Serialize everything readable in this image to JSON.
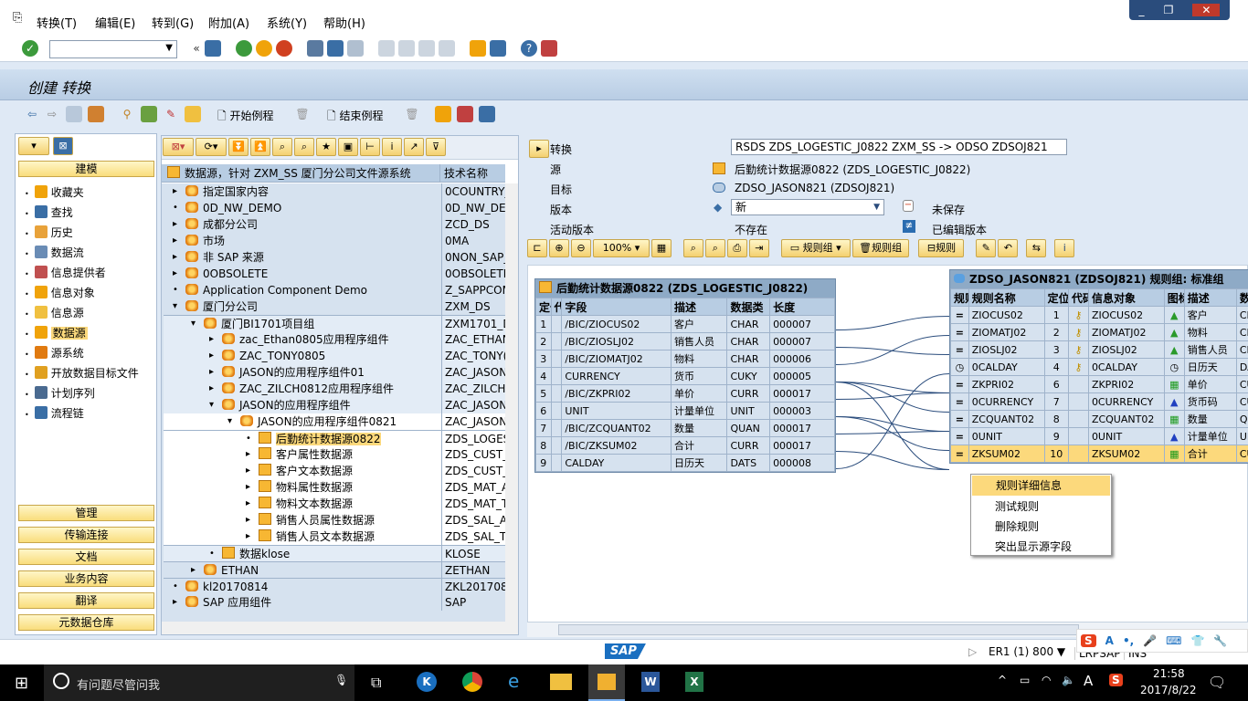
{
  "menu": [
    "转换(T)",
    "编辑(E)",
    "转到(G)",
    "附加(A)",
    "系统(Y)",
    "帮助(H)"
  ],
  "window_buttons": [
    "_",
    "❐",
    "✕"
  ],
  "command_field": "",
  "page_title": "创建 转换",
  "app_toolbar": {
    "start_routine": "开始例程",
    "end_routine": "结束例程"
  },
  "nav": {
    "top_button": "建模",
    "items": [
      {
        "label": "收藏夹",
        "color": "#f0a30a"
      },
      {
        "label": "查找",
        "color": "#3a6ea5"
      },
      {
        "label": "历史",
        "color": "#e8a23a"
      },
      {
        "label": "数据流",
        "color": "#6a8cb5"
      },
      {
        "label": "信息提供者",
        "color": "#c05050"
      },
      {
        "label": "信息对象",
        "color": "#f0a30a"
      },
      {
        "label": "信息源",
        "color": "#f0c040"
      },
      {
        "label": "数据源",
        "color": "#f0a30a",
        "selected": true
      },
      {
        "label": "源系统",
        "color": "#e07a10"
      },
      {
        "label": "开放数据目标文件",
        "color": "#e0a020"
      },
      {
        "label": "计划序列",
        "color": "#4a6a90"
      },
      {
        "label": "流程链",
        "color": "#3a6ea5"
      }
    ],
    "bottom_buttons": [
      "管理",
      "传输连接",
      "文档",
      "业务内容",
      "翻译",
      "元数据仓库"
    ]
  },
  "tree": {
    "header": "数据源，针对 ZXM_SS 厦门分公司文件源系统",
    "tech_header": "技术名称",
    "rows": [
      {
        "label": "指定国家内容",
        "tech": "0COUNTRY_",
        "level": 0,
        "exp": "▸",
        "icon": "folder"
      },
      {
        "label": "0D_NW_DEMO",
        "tech": "0D_NW_DEI",
        "level": 0,
        "exp": "•",
        "icon": "folder"
      },
      {
        "label": "成都分公司",
        "tech": "ZCD_DS",
        "level": 0,
        "exp": "▸",
        "icon": "folder"
      },
      {
        "label": "市场",
        "tech": "0MA",
        "level": 0,
        "exp": "▸",
        "icon": "folder"
      },
      {
        "label": "非 SAP 来源",
        "tech": "0NON_SAP_",
        "level": 0,
        "exp": "▸",
        "icon": "folder"
      },
      {
        "label": "0OBSOLETE",
        "tech": "0OBSOLETE",
        "level": 0,
        "exp": "▸",
        "icon": "folder"
      },
      {
        "label": "Application Component Demo",
        "tech": "Z_SAPPCOM",
        "level": 0,
        "exp": "•",
        "icon": "folder"
      },
      {
        "label": "厦门分公司",
        "tech": "ZXM_DS",
        "level": 0,
        "exp": "▾",
        "icon": "folder"
      },
      {
        "label": "厦门BI1701项目组",
        "tech": "ZXM1701_D",
        "level": 1,
        "exp": "▾",
        "icon": "folder"
      },
      {
        "label": "zac_Ethan0805应用程序组件",
        "tech": "ZAC_ETHAN",
        "level": 2,
        "exp": "▸",
        "icon": "folder"
      },
      {
        "label": "ZAC_TONY0805",
        "tech": "ZAC_TONY(",
        "level": 2,
        "exp": "▸",
        "icon": "folder"
      },
      {
        "label": "JASON的应用程序组件01",
        "tech": "ZAC_JASON",
        "level": 2,
        "exp": "▸",
        "icon": "folder"
      },
      {
        "label": "ZAC_ZILCH0812应用程序组件",
        "tech": "ZAC_ZILCH0",
        "level": 2,
        "exp": "▸",
        "icon": "folder"
      },
      {
        "label": "JASON的应用程序组件",
        "tech": "ZAC_JASON",
        "level": 2,
        "exp": "▾",
        "icon": "folder"
      },
      {
        "label": "JASON的应用程序组件0821",
        "tech": "ZAC_JASON",
        "level": 3,
        "exp": "▾",
        "icon": "folder"
      },
      {
        "label": "后勤统计数据源0822",
        "tech": "ZDS_LOGES",
        "level": 4,
        "exp": "•",
        "icon": "ds",
        "selected": true
      },
      {
        "label": "客户属性数据源",
        "tech": "ZDS_CUST_",
        "level": 4,
        "exp": "▸",
        "icon": "ds"
      },
      {
        "label": "客户文本数据源",
        "tech": "ZDS_CUST_",
        "level": 4,
        "exp": "▸",
        "icon": "ds"
      },
      {
        "label": "物料属性数据源",
        "tech": "ZDS_MAT_A",
        "level": 4,
        "exp": "▸",
        "icon": "ds"
      },
      {
        "label": "物料文本数据源",
        "tech": "ZDS_MAT_T",
        "level": 4,
        "exp": "▸",
        "icon": "ds"
      },
      {
        "label": "销售人员属性数据源",
        "tech": "ZDS_SAL_A",
        "level": 4,
        "exp": "▸",
        "icon": "ds"
      },
      {
        "label": "销售人员文本数据源",
        "tech": "ZDS_SAL_T",
        "level": 4,
        "exp": "▸",
        "icon": "ds"
      },
      {
        "label": "数据klose",
        "tech": "KLOSE",
        "level": 2,
        "exp": "•",
        "icon": "ds"
      },
      {
        "label": "ETHAN",
        "tech": "ZETHAN",
        "level": 1,
        "exp": "▸",
        "icon": "folder"
      },
      {
        "label": "kl20170814",
        "tech": "ZKL2017081",
        "level": 0,
        "exp": "•",
        "icon": "folder"
      },
      {
        "label": "SAP 应用组件",
        "tech": "SAP",
        "level": 0,
        "exp": "▸",
        "icon": "folder"
      }
    ]
  },
  "transform": {
    "label_transform": "转换",
    "value_transform": "RSDS ZDS_LOGESTIC_J0822 ZXM_SS -> ODSO ZDSOJ821",
    "label_source": "源",
    "value_source": "后勤统计数据源0822 (ZDS_LOGESTIC_J0822)",
    "label_target": "目标",
    "value_target": "ZDSO_JASON821 (ZDSOJ821)",
    "label_version": "版本",
    "value_version": "新",
    "status_version": "未保存",
    "label_active": "活动版本",
    "value_active": "不存在",
    "status_active": "已编辑版本"
  },
  "graph_toolbar": {
    "zoom": "100%",
    "rule_group_new": "规则组",
    "rule_group_delete": "规则组",
    "rule": "规则"
  },
  "source_table": {
    "title": "后勤统计数据源0822 (ZDS_LOGESTIC_J0822)",
    "columns": [
      "定位",
      "代",
      "字段",
      "描述",
      "数据类",
      "长度"
    ],
    "rows": [
      [
        "1",
        "",
        "/BIC/ZIOCUS02",
        "客户",
        "CHAR",
        "000007"
      ],
      [
        "2",
        "",
        "/BIC/ZIOSLJ02",
        "销售人员",
        "CHAR",
        "000007"
      ],
      [
        "3",
        "",
        "/BIC/ZIOMATJ02",
        "物料",
        "CHAR",
        "000006"
      ],
      [
        "4",
        "",
        "CURRENCY",
        "货币",
        "CUKY",
        "000005"
      ],
      [
        "5",
        "",
        "/BIC/ZKPRI02",
        "单价",
        "CURR",
        "000017"
      ],
      [
        "6",
        "",
        "UNIT",
        "计量单位",
        "UNIT",
        "000003"
      ],
      [
        "7",
        "",
        "/BIC/ZCQUANT02",
        "数量",
        "QUAN",
        "000017"
      ],
      [
        "8",
        "",
        "/BIC/ZKSUM02",
        "合计",
        "CURR",
        "000017"
      ],
      [
        "9",
        "",
        "CALDAY",
        "日历天",
        "DATS",
        "000008"
      ]
    ]
  },
  "target_table": {
    "title": "ZDSO_JASON821 (ZDSOJ821) 规则组: 标准组",
    "columns": [
      "规则",
      "规则名称",
      "定位",
      "代码",
      "信息对象",
      "图标",
      "描述",
      "数"
    ],
    "rows": [
      [
        "=",
        "ZIOCUS02",
        "1",
        "key",
        "ZIOCUS02",
        "char",
        "客户",
        "CH"
      ],
      [
        "=",
        "ZIOMATJ02",
        "2",
        "key",
        "ZIOMATJ02",
        "char",
        "物料",
        "CH"
      ],
      [
        "=",
        "ZIOSLJ02",
        "3",
        "key",
        "ZIOSLJ02",
        "char",
        "销售人员",
        "CH"
      ],
      [
        "◷",
        "0CALDAY",
        "4",
        "key",
        "0CALDAY",
        "time",
        "日历天",
        "DA"
      ],
      [
        "=",
        "ZKPRI02",
        "6",
        "",
        "ZKPRI02",
        "kf",
        "单价",
        "CU"
      ],
      [
        "=",
        "0CURRENCY",
        "7",
        "",
        "0CURRENCY",
        "unit",
        "货币码",
        "CU"
      ],
      [
        "=",
        "ZCQUANT02",
        "8",
        "",
        "ZCQUANT02",
        "kf",
        "数量",
        "QU"
      ],
      [
        "=",
        "0UNIT",
        "9",
        "",
        "0UNIT",
        "unit",
        "计量单位",
        "UN"
      ],
      [
        "=",
        "ZKSUM02",
        "10",
        "",
        "ZKSUM02",
        "kf",
        "合计",
        "CU"
      ]
    ],
    "selected_row": 8
  },
  "mappings": [
    [
      1,
      1
    ],
    [
      2,
      3
    ],
    [
      3,
      2
    ],
    [
      4,
      6
    ],
    [
      4,
      5
    ],
    [
      4,
      9
    ],
    [
      5,
      5
    ],
    [
      6,
      8
    ],
    [
      6,
      7
    ],
    [
      7,
      7
    ],
    [
      8,
      9
    ],
    [
      9,
      4
    ]
  ],
  "context_menu": [
    "规则详细信息",
    "测试规则",
    "删除规则",
    "突出显示源字段"
  ],
  "status_bar": {
    "logo": "SAP",
    "system": "ER1 (1) 800",
    "server": "LRPSAP",
    "mode": "INS"
  },
  "ime_toolbar": {
    "logo": "S",
    "mode": "A"
  },
  "taskbar": {
    "search": "有问题尽管问我",
    "time": "21:58",
    "date": "2017/8/22",
    "ime": "A"
  },
  "colors": {
    "accent_yellow": "#f9dd7c",
    "selected_row": "#fcd97c",
    "header_blue": "#8eaac6"
  }
}
